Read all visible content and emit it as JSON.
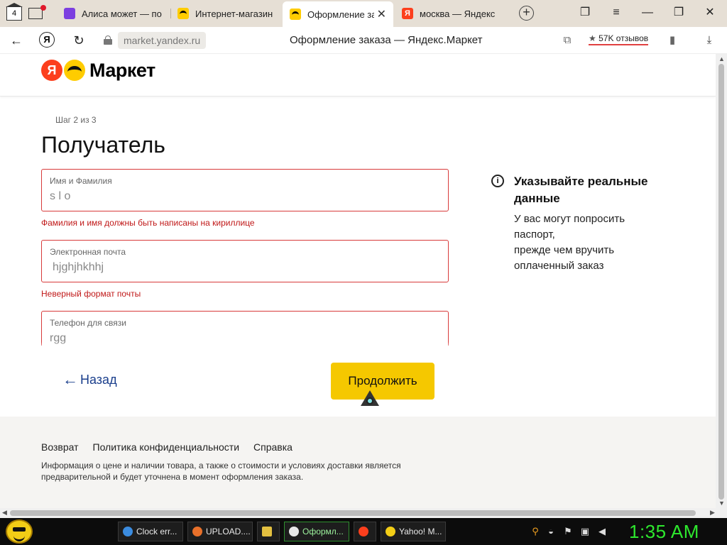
{
  "browser": {
    "tab_counter": "4",
    "tabs": [
      {
        "title": "Алиса может — по",
        "icon": "alice-icon"
      },
      {
        "title": "Интернет-магазин",
        "icon": "market-icon"
      },
      {
        "title": "Оформление за",
        "icon": "market-icon",
        "active": true
      },
      {
        "title": "москва — Яндекс",
        "icon": "yandex-icon"
      }
    ],
    "url": "market.yandex.ru",
    "page_title": "Оформление заказа — Яндекс.Маркет",
    "reviews": "57K отзывов"
  },
  "header": {
    "logo_letter": "Я",
    "logo_text": "Маркет"
  },
  "form": {
    "step": "Шаг 2 из 3",
    "title": "Получатель",
    "name": {
      "label": "Имя и Фамилия",
      "value": "s l o",
      "error": "Фамилия и имя должны быть написаны на кириллице"
    },
    "email": {
      "label": "Электронная почта",
      "value": "hjghjhkhhj",
      "error": "Неверный формат почты"
    },
    "phone": {
      "label": "Телефон для связи",
      "value": "rgg"
    }
  },
  "info": {
    "icon_glyph": "i",
    "title": "Указывайте реальные данные",
    "desc_lines": [
      "У вас могут попросить паспорт,",
      "прежде чем вручить",
      "оплаченный заказ"
    ]
  },
  "actions": {
    "back": "Назад",
    "continue": "Продолжить"
  },
  "footer": {
    "links": [
      "Возврат",
      "Политика конфиденциальности",
      "Справка"
    ],
    "note": "Информация о цене и наличии товара, а также о стоимости и условиях доставки является предварительной и будет уточнена в момент оформления заказа."
  },
  "taskbar": {
    "tasks": [
      {
        "label": "Clock err...",
        "color": "#3b8ce0"
      },
      {
        "label": "UPLOAD....",
        "color": "#e8702a"
      },
      {
        "label": "",
        "color": "#e3c040"
      },
      {
        "label": "Оформл...",
        "color": "#e8e8e8"
      },
      {
        "label": "",
        "color": "#fc3f1d"
      },
      {
        "label": "Yahoo! M...",
        "color": "#f2cd16"
      }
    ],
    "time": "1:35 AM"
  },
  "colors": {
    "accent_yellow": "#f5c800",
    "error_red": "#c01818",
    "link_blue": "#1a3e8c",
    "clock_green": "#2ee82e"
  }
}
